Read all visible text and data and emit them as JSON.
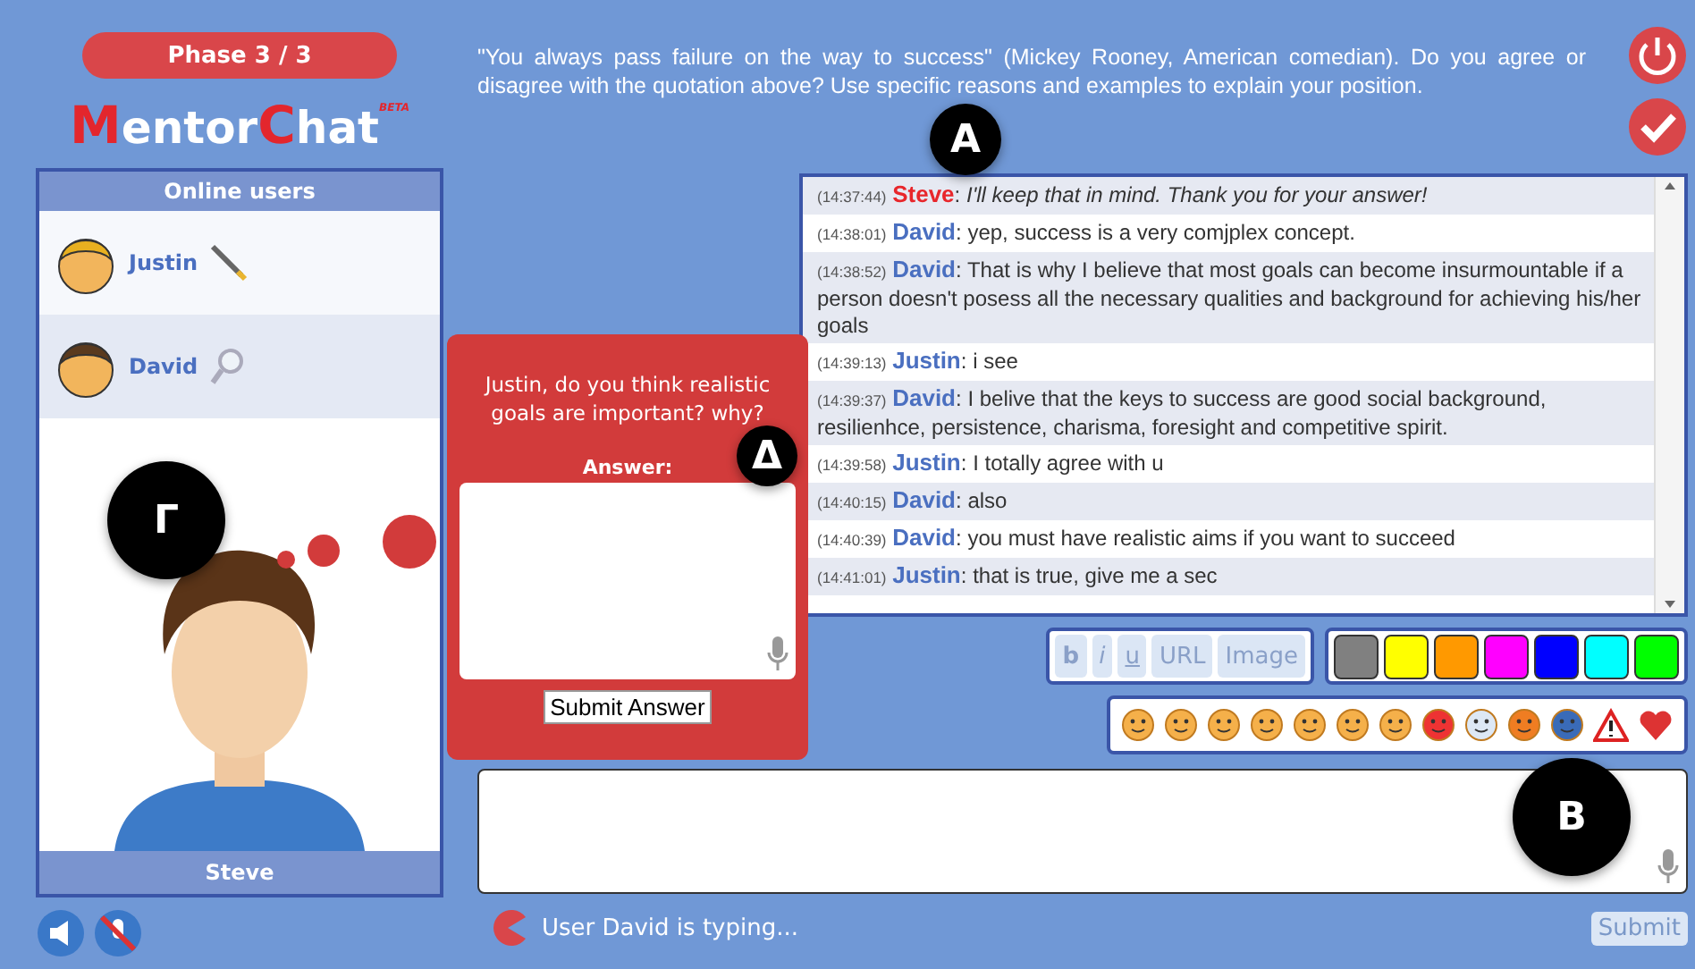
{
  "phase": "Phase 3 / 3",
  "logo": {
    "parts": [
      {
        "text": "M",
        "accent": true
      },
      {
        "text": "entor",
        "accent": false
      },
      {
        "text": "C",
        "accent": true
      },
      {
        "text": "hat",
        "accent": false
      }
    ],
    "badge": "BETA"
  },
  "quote": "\"You always pass failure on the way to success\" (Mickey Rooney, American comedian). Do you agree or disagree with the quotation above? Use specific reasons and examples to explain your position.",
  "online_users": {
    "title": "Online users",
    "users": [
      {
        "name": "Justin",
        "kind": "writing",
        "selected": false
      },
      {
        "name": "David",
        "kind": "searching",
        "selected": true
      }
    ],
    "agent_name": "Steve"
  },
  "chat_separator": ":",
  "messages": [
    {
      "time": "(14:37:44)",
      "user": "Steve",
      "color": "#e8262b",
      "kind": "agent",
      "text": "I'll keep that in mind. Thank you for your answer!"
    },
    {
      "time": "(14:38:01)",
      "user": "David",
      "color": "#4a6fc0",
      "kind": "peer",
      "text": "yep, success is a very comjplex concept."
    },
    {
      "time": "(14:38:52)",
      "user": "David",
      "color": "#4a6fc0",
      "kind": "peer",
      "text": "That is why I believe that most goals can become insurmountable if a person doesn't posess all the necessary qualities and background for achieving his/her goals"
    },
    {
      "time": "(14:39:13)",
      "user": "Justin",
      "color": "#4a6fc0",
      "kind": "peer",
      "text": "i see"
    },
    {
      "time": "(14:39:37)",
      "user": "David",
      "color": "#4a6fc0",
      "kind": "peer",
      "text": "I belive that the keys to success are good social background, resilienhce, persistence, charisma, foresight and competitive spirit."
    },
    {
      "time": "(14:39:58)",
      "user": "Justin",
      "color": "#4a6fc0",
      "kind": "peer",
      "text": "I totally agree with u"
    },
    {
      "time": "(14:40:15)",
      "user": "David",
      "color": "#4a6fc0",
      "kind": "peer",
      "text": "also"
    },
    {
      "time": "(14:40:39)",
      "user": "David",
      "color": "#4a6fc0",
      "kind": "peer",
      "text": "you must have realistic aims if you want to succeed"
    },
    {
      "time": "(14:41:01)",
      "user": "Justin",
      "color": "#4a6fc0",
      "kind": "peer",
      "text": "that is true, give me a sec"
    }
  ],
  "format_buttons": [
    {
      "label": "b",
      "kind": "bold"
    },
    {
      "label": "i",
      "kind": "italic"
    },
    {
      "label": "u",
      "kind": "underline"
    },
    {
      "label": "URL",
      "kind": "plain"
    },
    {
      "label": "Image",
      "kind": "plain"
    }
  ],
  "colors": [
    {
      "color": "#808080"
    },
    {
      "color": "#ffff00"
    },
    {
      "color": "#ff9900"
    },
    {
      "color": "#ff00ff"
    },
    {
      "color": "#0000ff"
    },
    {
      "color": "#00ffff"
    },
    {
      "color": "#00ff00"
    }
  ],
  "popup": {
    "question": "Justin, do you think realistic goals are important? why?",
    "answer_label": "Answer:",
    "submit": "Submit Answer"
  },
  "status": "User David is typing...",
  "submit": "Submit",
  "markers": [
    {
      "label": "A"
    },
    {
      "label": "B"
    },
    {
      "label": "Γ"
    },
    {
      "label": "Δ"
    }
  ]
}
